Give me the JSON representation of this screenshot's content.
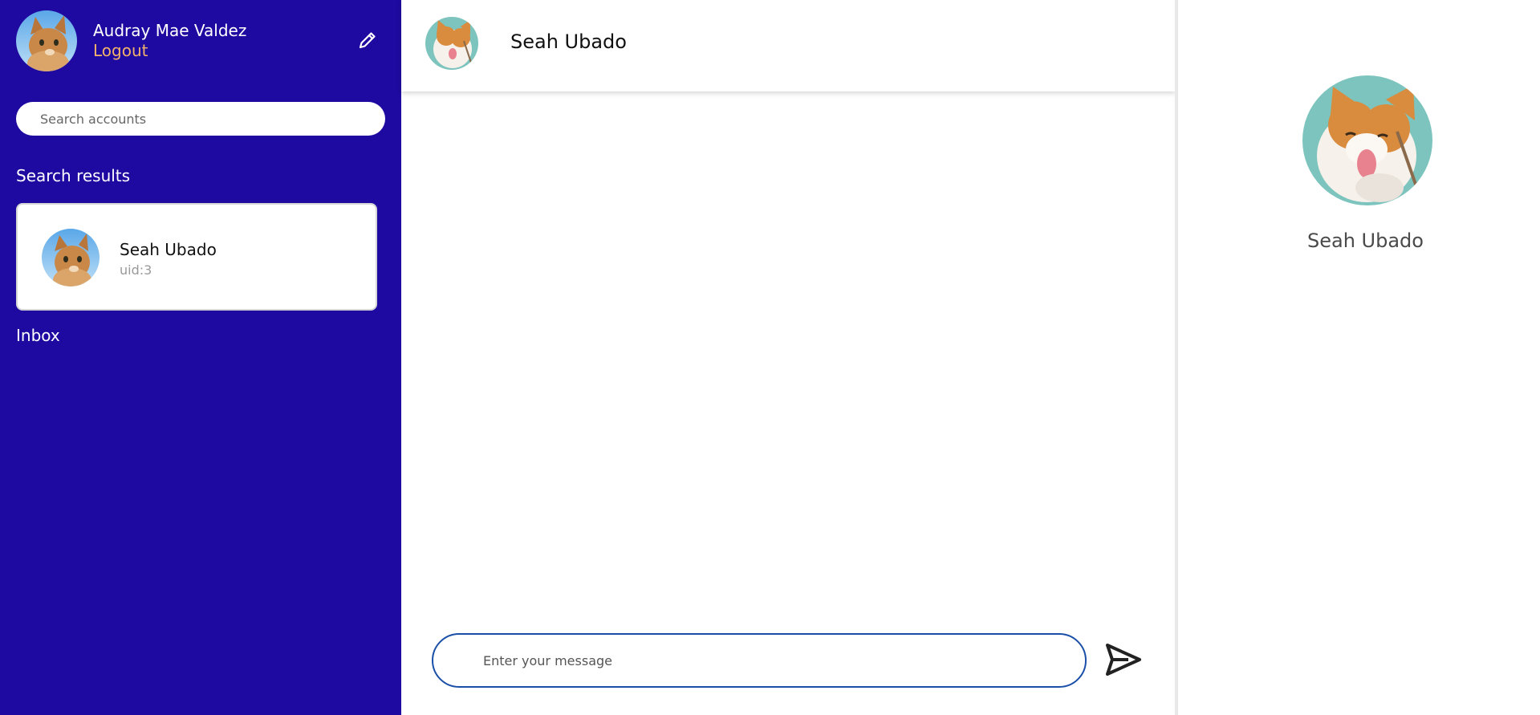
{
  "sidebar": {
    "user_name": "Audray Mae Valdez",
    "logout_label": "Logout",
    "search_placeholder": "Search accounts",
    "search_results_title": "Search results",
    "results": [
      {
        "name": "Seah Ubado",
        "uid": "uid:3"
      }
    ],
    "inbox_title": "Inbox"
  },
  "chat": {
    "contact_name": "Seah Ubado",
    "message_placeholder": "Enter your message"
  },
  "details_panel": {
    "contact_name": "Seah Ubado"
  },
  "colors": {
    "sidebar_bg": "#1e0aa0",
    "logout": "#f3b26b",
    "input_border": "#1a4fa8"
  }
}
